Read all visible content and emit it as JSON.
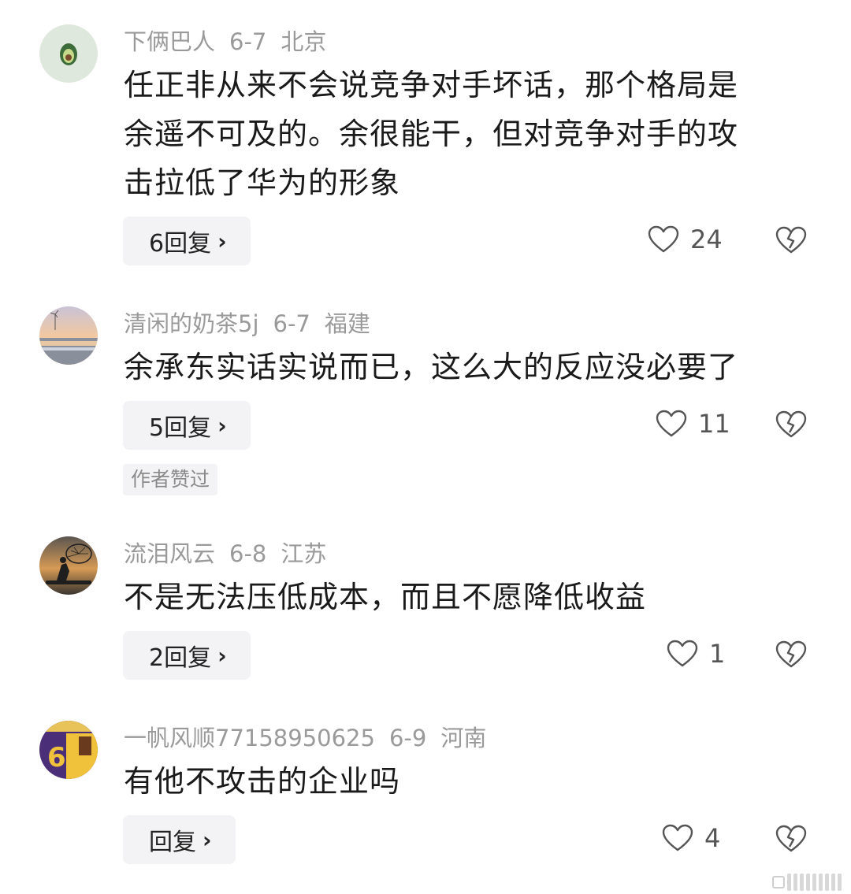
{
  "comments": [
    {
      "username": "下俩巴人",
      "date": "6-7",
      "location": "北京",
      "lines": [
        "任正非从来不会说竞争对手坏话，那个格局是",
        "余遥不可及的。余很能干，但对竞争对手的攻",
        "击拉低了华为的形象"
      ],
      "reply_label": "6回复",
      "like_count": "24",
      "avatar_icon": "avocado-avatar"
    },
    {
      "username": "清闲的奶茶5j",
      "date": "6-7",
      "location": "福建",
      "lines": [
        "余承东实话实说而已，这么大的反应没必要了"
      ],
      "reply_label": "5回复",
      "like_count": "11",
      "author_liked": "作者赞过",
      "avatar_icon": "sunset-beach-avatar"
    },
    {
      "username": "流泪风云",
      "date": "6-8",
      "location": "江苏",
      "lines": [
        "不是无法压低成本，而且不愿降低收益"
      ],
      "reply_label": "2回复",
      "like_count": "1",
      "avatar_icon": "fisherman-silhouette-avatar"
    },
    {
      "username": "一帆风顺77158950625",
      "date": "6-9",
      "location": "河南",
      "lines": [
        "有他不攻击的企业吗"
      ],
      "reply_label": "回复",
      "like_count": "4",
      "avatar_icon": "basketball-jersey-avatar"
    }
  ],
  "colors": {
    "meta_text": "#9a9a9a",
    "body_text": "#1a1a1a",
    "button_bg": "#f3f3f5"
  }
}
